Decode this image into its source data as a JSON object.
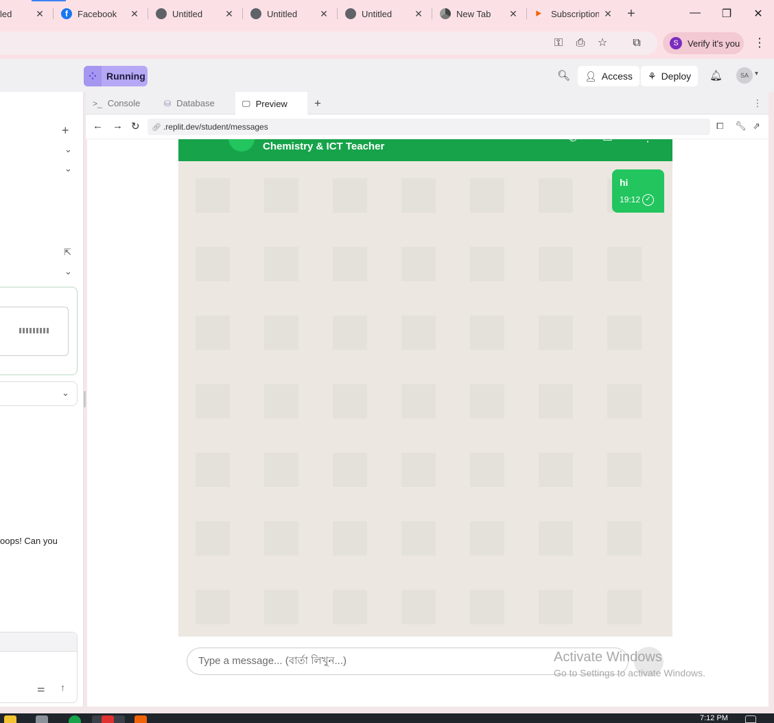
{
  "browser": {
    "tabs": [
      {
        "title": "led",
        "icon": "globe-icon"
      },
      {
        "title": "Facebook",
        "icon": "facebook-icon"
      },
      {
        "title": "Untitled",
        "icon": "globe-icon"
      },
      {
        "title": "Untitled",
        "icon": "globe-icon"
      },
      {
        "title": "Untitled",
        "icon": "globe-icon"
      },
      {
        "title": "New Tab",
        "icon": "chrome-icon"
      },
      {
        "title": "Subscription",
        "icon": "replit-icon"
      }
    ],
    "profile_initial": "S",
    "verify_label": "Verify it's you",
    "accent_color": "#3b82f6"
  },
  "header": {
    "run_status": "Running",
    "access_label": "Access",
    "deploy_label": "Deploy",
    "user_initials": "SA",
    "run_color": "#b7a8f5"
  },
  "pane_tabs": [
    {
      "label": "Console",
      "icon": ">_"
    },
    {
      "label": "Database",
      "icon": "database-icon"
    },
    {
      "label": "Preview",
      "icon": "monitor-icon"
    }
  ],
  "preview_toolbar": {
    "url": ".replit.dev/student/messages"
  },
  "left_panel": {
    "message_snippet": "oops! Can you"
  },
  "chat": {
    "contact_subtitle": "Chemistry & ICT Teacher",
    "header_color": "#16a34a",
    "messages": [
      {
        "text": "hi",
        "time": "19:12",
        "status": "read"
      }
    ],
    "input_placeholder": "Type a message... (বার্তা লিখুন...)"
  },
  "os": {
    "watermark_title": "Activate Windows",
    "watermark_sub": "Go to Settings to activate Windows.",
    "clock": "7:12 PM"
  }
}
